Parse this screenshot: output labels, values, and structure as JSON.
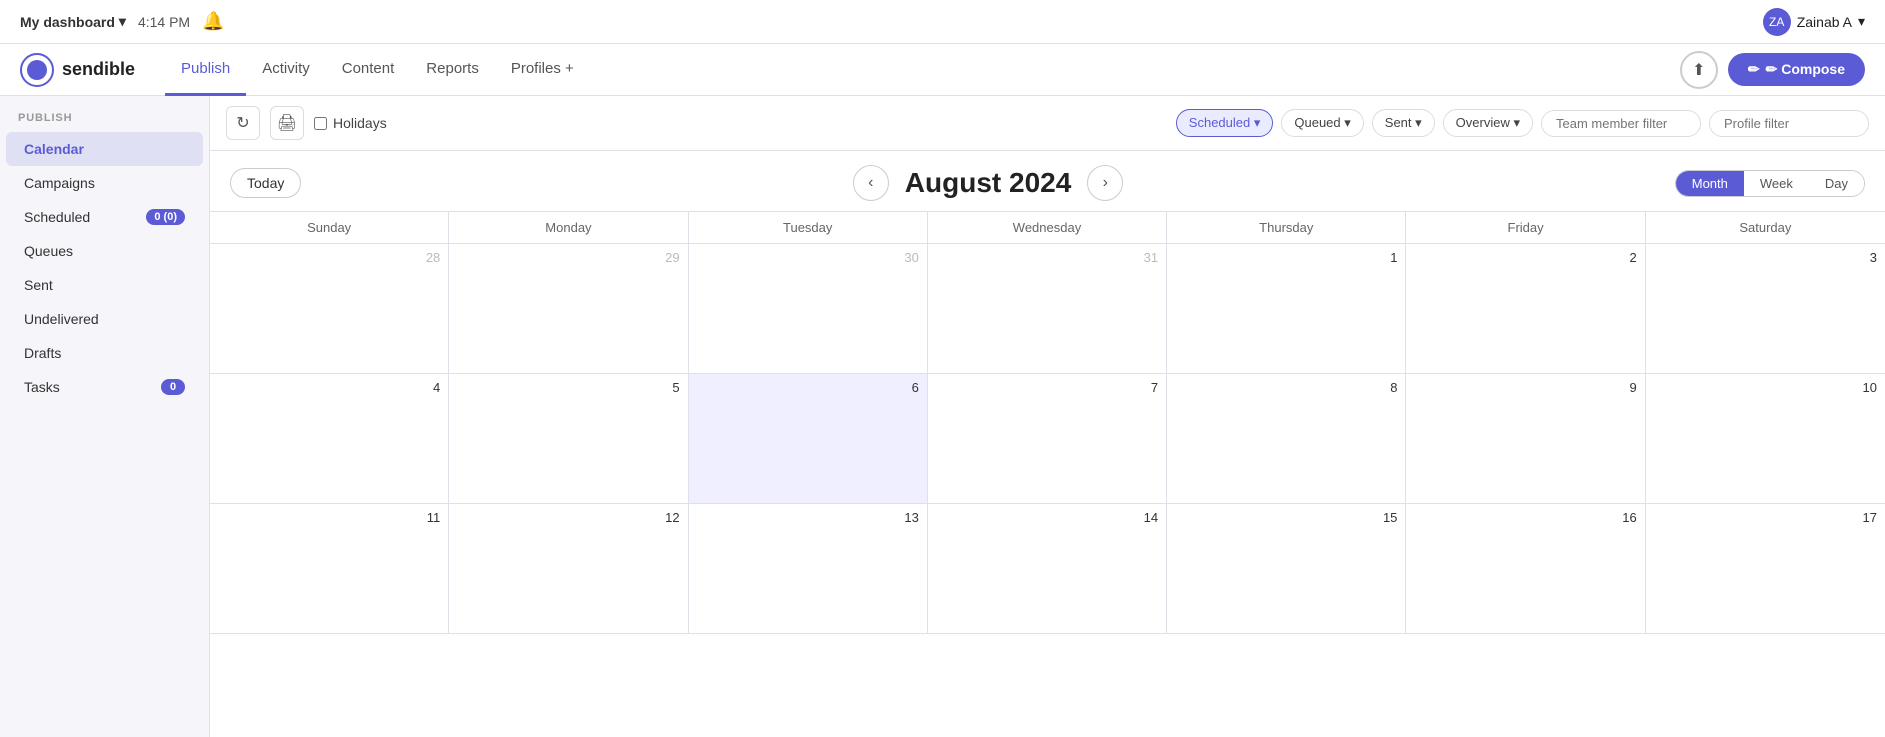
{
  "topbar": {
    "dashboard_title": "My dashboard",
    "time": "4:14 PM",
    "user_name": "Zainab A",
    "user_initials": "ZA",
    "chevron_down": "▾",
    "bell_label": "🔔"
  },
  "nav": {
    "logo_text": "sendible",
    "links": [
      {
        "id": "publish",
        "label": "Publish",
        "active": true
      },
      {
        "id": "activity",
        "label": "Activity",
        "active": false
      },
      {
        "id": "content",
        "label": "Content",
        "active": false
      },
      {
        "id": "reports",
        "label": "Reports",
        "active": false
      },
      {
        "id": "profiles",
        "label": "Profiles +",
        "active": false
      }
    ],
    "compose_label": "✏ Compose",
    "upload_label": "⬆"
  },
  "sidebar": {
    "section_label": "PUBLISH",
    "items": [
      {
        "id": "calendar",
        "label": "Calendar",
        "active": true,
        "badge": null
      },
      {
        "id": "campaigns",
        "label": "Campaigns",
        "active": false,
        "badge": null
      },
      {
        "id": "scheduled",
        "label": "Scheduled",
        "active": false,
        "badge": "0 (0)"
      },
      {
        "id": "queues",
        "label": "Queues",
        "active": false,
        "badge": null
      },
      {
        "id": "sent",
        "label": "Sent",
        "active": false,
        "badge": null
      },
      {
        "id": "undelivered",
        "label": "Undelivered",
        "active": false,
        "badge": null
      },
      {
        "id": "drafts",
        "label": "Drafts",
        "active": false,
        "badge": null
      },
      {
        "id": "tasks",
        "label": "Tasks",
        "active": false,
        "badge": "0"
      }
    ]
  },
  "toolbar": {
    "holidays_label": "Holidays",
    "filters": [
      {
        "id": "scheduled",
        "label": "Scheduled ▾",
        "active": true
      },
      {
        "id": "queued",
        "label": "Queued ▾",
        "active": false
      },
      {
        "id": "sent",
        "label": "Sent ▾",
        "active": false
      },
      {
        "id": "overview",
        "label": "Overview ▾",
        "active": false
      }
    ],
    "team_member_placeholder": "Team member filter",
    "profile_placeholder": "Profile filter"
  },
  "calendar": {
    "title": "August 2024",
    "today_label": "Today",
    "views": [
      "Month",
      "Week",
      "Day"
    ],
    "active_view": "Month",
    "day_headers": [
      "Sunday",
      "Monday",
      "Tuesday",
      "Wednesday",
      "Thursday",
      "Friday",
      "Saturday"
    ],
    "weeks": [
      [
        {
          "num": "28",
          "other": true,
          "today": false,
          "highlighted": false
        },
        {
          "num": "29",
          "other": true,
          "today": false,
          "highlighted": false
        },
        {
          "num": "30",
          "other": true,
          "today": false,
          "highlighted": false
        },
        {
          "num": "31",
          "other": true,
          "today": false,
          "highlighted": false
        },
        {
          "num": "1",
          "other": false,
          "today": false,
          "highlighted": false
        },
        {
          "num": "2",
          "other": false,
          "today": false,
          "highlighted": false
        },
        {
          "num": "3",
          "other": false,
          "today": false,
          "highlighted": false
        }
      ],
      [
        {
          "num": "4",
          "other": false,
          "today": false,
          "highlighted": false
        },
        {
          "num": "5",
          "other": false,
          "today": false,
          "highlighted": false
        },
        {
          "num": "6",
          "other": false,
          "today": true,
          "highlighted": true
        },
        {
          "num": "7",
          "other": false,
          "today": false,
          "highlighted": false
        },
        {
          "num": "8",
          "other": false,
          "today": false,
          "highlighted": false
        },
        {
          "num": "9",
          "other": false,
          "today": false,
          "highlighted": false
        },
        {
          "num": "10",
          "other": false,
          "today": false,
          "highlighted": false
        }
      ],
      [
        {
          "num": "11",
          "other": false,
          "today": false,
          "highlighted": false
        },
        {
          "num": "12",
          "other": false,
          "today": false,
          "highlighted": false
        },
        {
          "num": "13",
          "other": false,
          "today": false,
          "highlighted": false
        },
        {
          "num": "14",
          "other": false,
          "today": false,
          "highlighted": false
        },
        {
          "num": "15",
          "other": false,
          "today": false,
          "highlighted": false
        },
        {
          "num": "16",
          "other": false,
          "today": false,
          "highlighted": false
        },
        {
          "num": "17",
          "other": false,
          "today": false,
          "highlighted": false
        }
      ]
    ]
  }
}
